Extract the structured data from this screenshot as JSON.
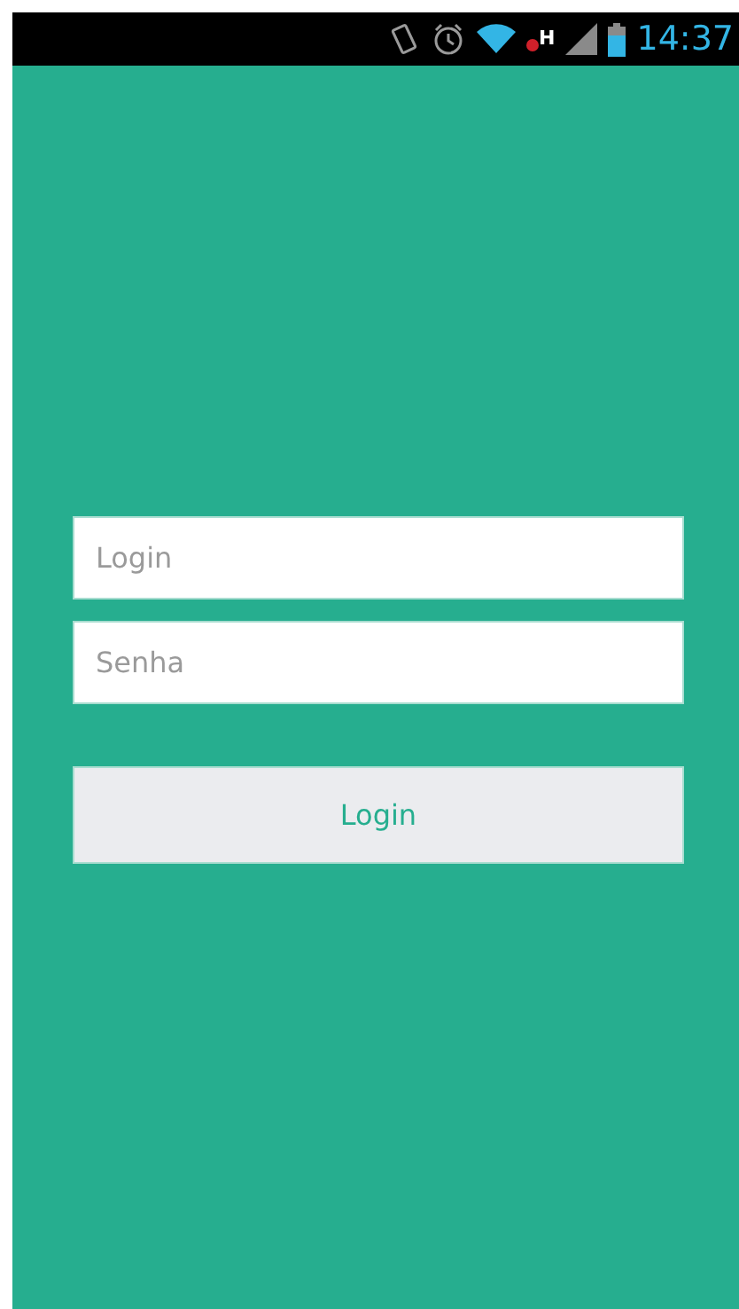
{
  "status_bar": {
    "network_type": "H",
    "time": "14:37"
  },
  "login_form": {
    "fields": [
      {
        "placeholder": "Login"
      },
      {
        "placeholder": "Senha"
      }
    ],
    "button": "Login"
  }
}
